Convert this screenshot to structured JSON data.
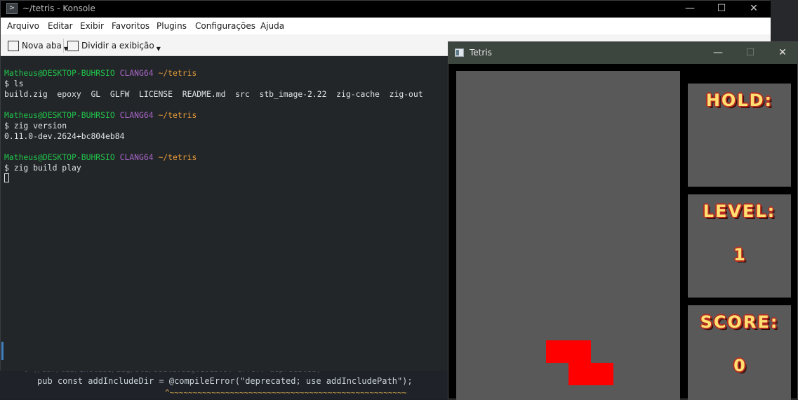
{
  "background_editor": {
    "line0": "  t (/usr/lib/include/zig/std/build.zig:1013:9: error: deprecated)",
    "line1": "pub const addIncludeDir = @compileError(\"deprecated; use addIncludePath\");",
    "line2": "^~~~~~~~~~~~~~~~~~~~~~~~~~~~~~~~~~~~~~~~~~~~~~~~~~~~"
  },
  "konsole": {
    "title": "~/tetris - Konsole",
    "menu": [
      "Arquivo",
      "Editar",
      "Exibir",
      "Favoritos",
      "Plugins",
      "Configurações",
      "Ajuda"
    ],
    "toolbar": {
      "new_tab": "Nova aba",
      "split_view": "Dividir a exibição"
    },
    "prompt": {
      "user": "Matheus@DESKTOP-BUHRSIO",
      "env": "CLANG64",
      "path": "~/tetris"
    },
    "lines": {
      "cmd1": "$ ls",
      "out1": "build.zig  epoxy  GL  GLFW  LICENSE  README.md  src  stb_image-2.22  zig-cache  zig-out",
      "cmd2": "$ zig version",
      "out2": "0.11.0-dev.2624+bc804eb84",
      "cmd3": "$ zig build play"
    }
  },
  "tetris": {
    "title": "Tetris",
    "hold_label": "HOLD:",
    "level_label": "LEVEL:",
    "level_value": "1",
    "score_label": "SCORE:",
    "score_value": "0",
    "piece_color": "#ff0000",
    "board_color": "#595959"
  }
}
